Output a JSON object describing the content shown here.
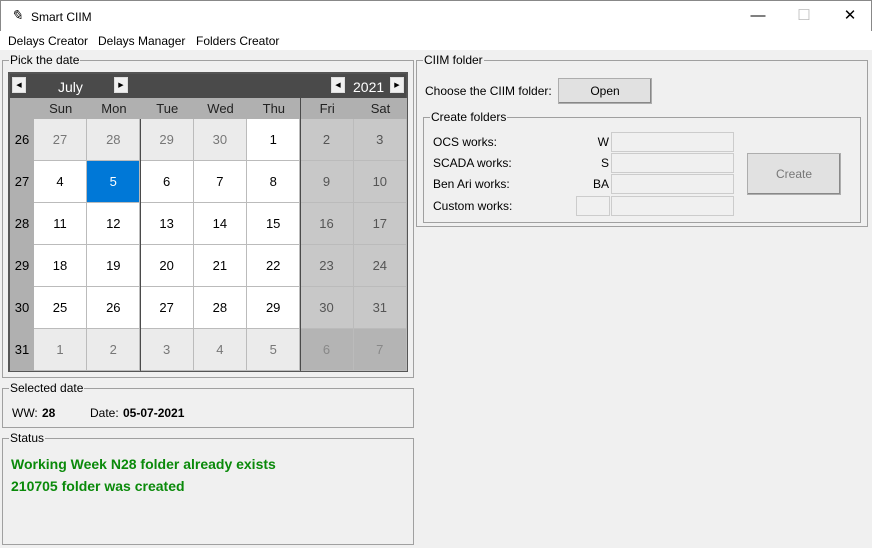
{
  "window": {
    "title": "Smart CIIM",
    "icon": "feather-icon",
    "minimize": "—",
    "maximize": "☐",
    "close": "✕"
  },
  "menu": [
    "Delays Creator",
    "Delays Manager",
    "Folders Creator"
  ],
  "calendar": {
    "frame_label": "Pick the date",
    "month": "July",
    "year": "2021",
    "day_names": [
      "Sun",
      "Mon",
      "Tue",
      "Wed",
      "Thu",
      "Fri",
      "Sat"
    ],
    "selected": "5",
    "weeks": [
      {
        "wk": "26",
        "days": [
          "27",
          "28",
          "29",
          "30",
          "1",
          "2",
          "3"
        ],
        "other": [
          1,
          1,
          1,
          1,
          0,
          0,
          0
        ]
      },
      {
        "wk": "27",
        "days": [
          "4",
          "5",
          "6",
          "7",
          "8",
          "9",
          "10"
        ],
        "other": [
          0,
          0,
          0,
          0,
          0,
          0,
          0
        ]
      },
      {
        "wk": "28",
        "days": [
          "11",
          "12",
          "13",
          "14",
          "15",
          "16",
          "17"
        ],
        "other": [
          0,
          0,
          0,
          0,
          0,
          0,
          0
        ]
      },
      {
        "wk": "29",
        "days": [
          "18",
          "19",
          "20",
          "21",
          "22",
          "23",
          "24"
        ],
        "other": [
          0,
          0,
          0,
          0,
          0,
          0,
          0
        ]
      },
      {
        "wk": "30",
        "days": [
          "25",
          "26",
          "27",
          "28",
          "29",
          "30",
          "31"
        ],
        "other": [
          0,
          0,
          0,
          0,
          0,
          0,
          0
        ]
      },
      {
        "wk": "31",
        "days": [
          "1",
          "2",
          "3",
          "4",
          "5",
          "6",
          "7"
        ],
        "other": [
          1,
          1,
          1,
          1,
          1,
          1,
          1
        ]
      }
    ],
    "colors": {
      "header": "#4a4a4a",
      "selected": "#0078d7",
      "weekend": "#c8c8c8",
      "other_weekday": "#ebebeb",
      "other_weekend": "#b4b4b4"
    }
  },
  "selected_date": {
    "frame_label": "Selected date",
    "ww_label": "WW:",
    "ww": "28",
    "date_label": "Date:",
    "date": "05-07-2021"
  },
  "status": {
    "frame_label": "Status",
    "lines": [
      "Working Week N28 folder already exists",
      "210705 folder was created"
    ],
    "color": "#0a8a0a"
  },
  "ciim": {
    "frame_label": "CIIM folder",
    "choose_label": "Choose the CIIM folder:",
    "open_button": "Open",
    "create_frame_label": "Create folders",
    "rows": [
      {
        "label": "OCS works:",
        "prefix": "W",
        "value": ""
      },
      {
        "label": "SCADA works:",
        "prefix": "S",
        "value": ""
      },
      {
        "label": "Ben Ari works:",
        "prefix": "BA",
        "value": ""
      },
      {
        "label": "Custom works:",
        "prefix": "",
        "value": ""
      }
    ],
    "create_button": "Create"
  }
}
